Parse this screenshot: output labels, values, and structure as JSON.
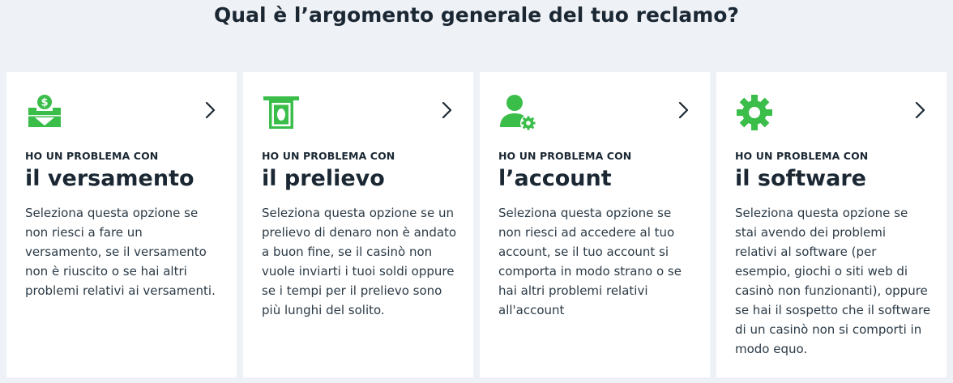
{
  "page": {
    "title": "Qual è l’argomento generale del tuo reclamo?"
  },
  "colors": {
    "accent_green": "#3bbd4a",
    "text_dark": "#1b2833",
    "background": "#eef1f6"
  },
  "cards": [
    {
      "icon": "deposit-icon",
      "kicker": "HO UN PROBLEMA CON",
      "heading": "il versamento",
      "description": "Seleziona questa opzione se non riesci a fare un versamento, se il versamento non è riuscito o se hai altri problemi relativi ai versamenti."
    },
    {
      "icon": "withdrawal-icon",
      "kicker": "HO UN PROBLEMA CON",
      "heading": "il prelievo",
      "description": "Seleziona questa opzione se un prelievo di denaro non è andato a buon fine, se il casinò non vuole inviarti i tuoi soldi oppure se i tempi per il prelievo sono più lunghi del solito."
    },
    {
      "icon": "account-icon",
      "kicker": "HO UN PROBLEMA CON",
      "heading": "l’account",
      "description": "Seleziona questa opzione se non riesci ad accedere al tuo account, se il tuo account si comporta in modo strano o se hai altri problemi relativi all'account"
    },
    {
      "icon": "gear-icon",
      "kicker": "HO UN PROBLEMA CON",
      "heading": "il software",
      "description": "Seleziona questa opzione se stai avendo dei problemi relativi al software (per esempio, giochi o siti web di casinò non funzionanti), oppure se hai il sospetto che il software di un casinò non si comporti in modo equo."
    }
  ]
}
